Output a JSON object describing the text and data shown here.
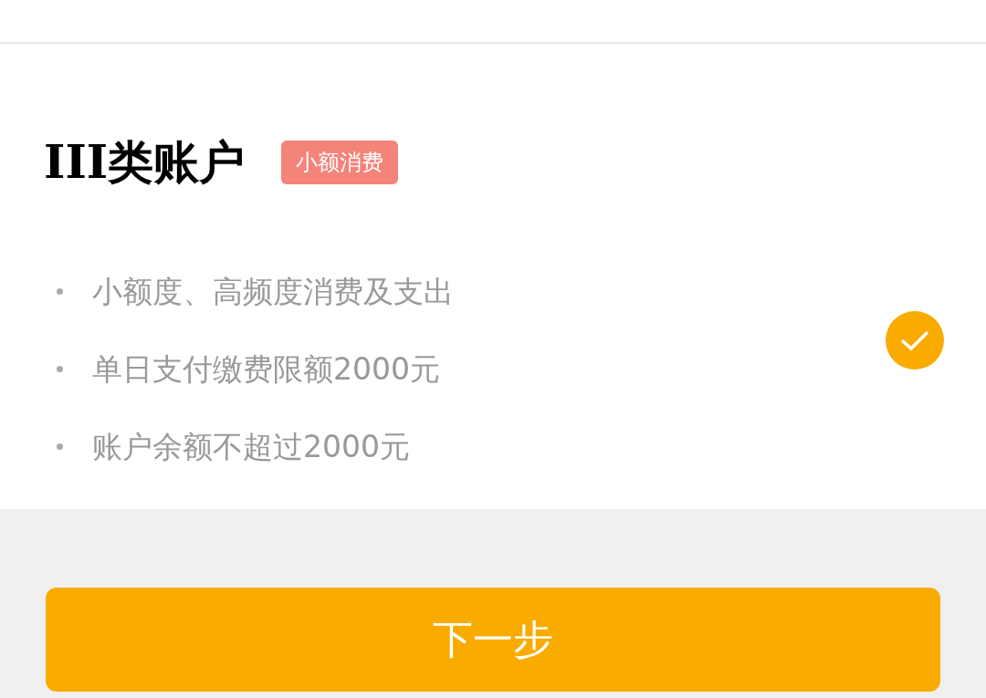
{
  "account": {
    "title": "III类账户",
    "tag": "小额消费",
    "selected": true,
    "features": [
      "小额度、高频度消费及支出",
      "单日支付缴费限额2000元",
      "账户余额不超过2000元"
    ]
  },
  "next_button": "下一步"
}
